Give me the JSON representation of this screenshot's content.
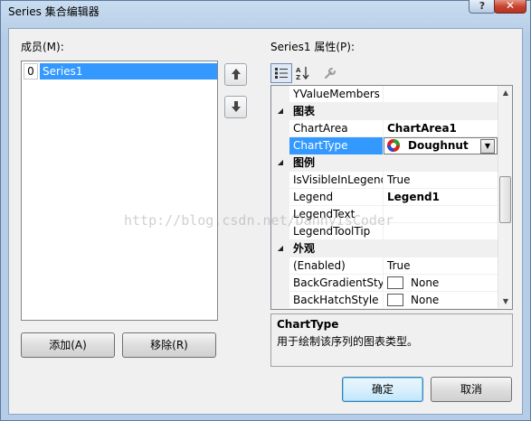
{
  "window": {
    "title": "Series 集合编辑器",
    "help_glyph": "?",
    "close_glyph": "✕"
  },
  "members": {
    "label": "成员(M):",
    "items": [
      {
        "index": "0",
        "name": "Series1"
      }
    ],
    "move_up_icon": "arrow-up-icon",
    "move_down_icon": "arrow-down-icon",
    "add_label": "添加(A)",
    "remove_label": "移除(R)"
  },
  "properties": {
    "label": "Series1 属性(P):",
    "toolbar": {
      "categorized_icon": "categorized-icon",
      "alphabetical_icon": "alphabetical-icon",
      "property_pages_icon": "wrench-icon"
    },
    "rows": [
      {
        "type": "prop",
        "name": "YValueMembers",
        "value": ""
      },
      {
        "type": "cat",
        "name": "图表"
      },
      {
        "type": "prop",
        "name": "ChartArea",
        "value": "ChartArea1",
        "bold": true
      },
      {
        "type": "prop",
        "name": "ChartType",
        "value": "Doughnut",
        "bold": true,
        "selected": true
      },
      {
        "type": "cat",
        "name": "图例"
      },
      {
        "type": "prop",
        "name": "IsVisibleInLegend",
        "value": "True"
      },
      {
        "type": "prop",
        "name": "Legend",
        "value": "Legend1",
        "bold": true
      },
      {
        "type": "prop",
        "name": "LegendText",
        "value": ""
      },
      {
        "type": "prop",
        "name": "LegendToolTip",
        "value": ""
      },
      {
        "type": "cat",
        "name": "外观"
      },
      {
        "type": "prop",
        "name": "(Enabled)",
        "value": "True"
      },
      {
        "type": "prop",
        "name": "BackGradientStyle",
        "value": "None",
        "swatch": true
      },
      {
        "type": "prop",
        "name": "BackHatchStyle",
        "value": "None",
        "swatch": true
      }
    ],
    "description": {
      "title": "ChartType",
      "text": "用于绘制该序列的图表类型。"
    }
  },
  "footer": {
    "ok_label": "确定",
    "cancel_label": "取消"
  },
  "watermark": "http://blog.csdn.net/DannyIsCoder",
  "colors": {
    "selection": "#3399ff",
    "title_bar": "#b5cde6",
    "close_button": "#c7422f"
  }
}
